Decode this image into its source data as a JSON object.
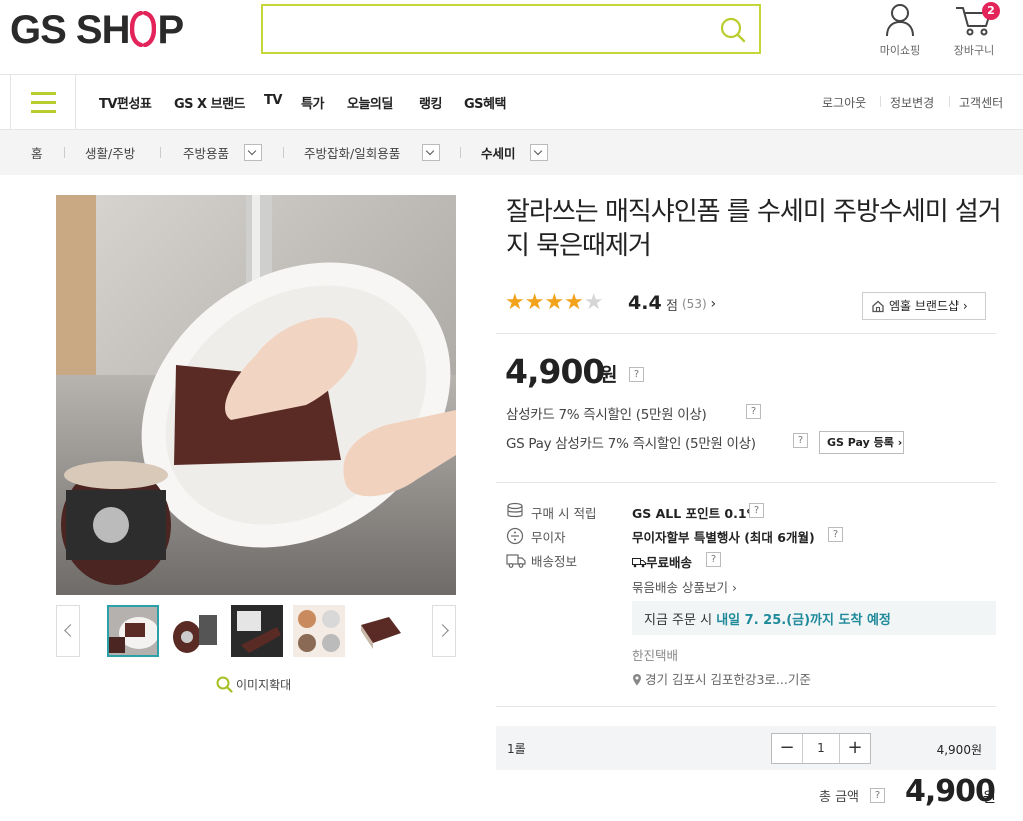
{
  "header": {
    "logo_text": "GS SH",
    "logo_suffix": "P",
    "search_placeholder": "",
    "mypage_label": "마이쇼핑",
    "cart_label": "장바구니",
    "cart_count": "2"
  },
  "nav": {
    "items": [
      "TV편성표",
      "GS X 브랜드",
      "TV",
      "특가",
      "오늘의딜",
      "랭킹",
      "GS혜택"
    ],
    "utils": [
      "로그아웃",
      "정보변경",
      "고객센터"
    ]
  },
  "breadcrumb": [
    "홈",
    "생활/주방",
    "주방용품",
    "주방잡화/일회용품",
    "수세미"
  ],
  "gallery": {
    "zoom_label": "이미지확대",
    "thumb_count": 5,
    "selected_thumb": 1
  },
  "product": {
    "title": "잘라쓰는 매직샤인폼 를 수세미 주방수세미 설거지 묵은때제거",
    "stars_filled": "★★★★",
    "stars_empty": "★",
    "rating": "4.4",
    "rating_unit": "점",
    "review_count": "(53)",
    "brandshop_label": "엠홀 브랜드샵",
    "price": "4,900",
    "price_unit": "원",
    "discount_1": "삼성카드 7% 즉시할인 (5만원 이상)",
    "discount_2": "GS Pay 삼성카드 7% 즉시할인 (5만원 이상)",
    "gspay_label": "GS Pay 등록"
  },
  "info": {
    "points_label": "구매 시 적립",
    "points_value": "GS ALL 포인트 0.1%",
    "interest_label": "무이자",
    "interest_value": "무이자할부 특별행사 (최대 6개월)",
    "delivery_label": "배송정보",
    "delivery_value": "무료배송",
    "bundle_link": "묶음배송 상품보기 ›",
    "arrival_prefix": "지금 주문 시",
    "arrival_date": "내일 7. 25.(금)까지 도착 예정",
    "courier": "한진택배",
    "origin": "경기 김포시 김포한강3로...기준"
  },
  "order": {
    "option_label": "1롤",
    "qty": "1",
    "option_price": "4,900원",
    "total_label": "총 금액",
    "total_price": "4,900",
    "total_unit": "원"
  },
  "colors": {
    "accent": "#c5d639",
    "badge": "#e2245a",
    "teal": "#1e8a9a",
    "star": "#f2a21b"
  }
}
